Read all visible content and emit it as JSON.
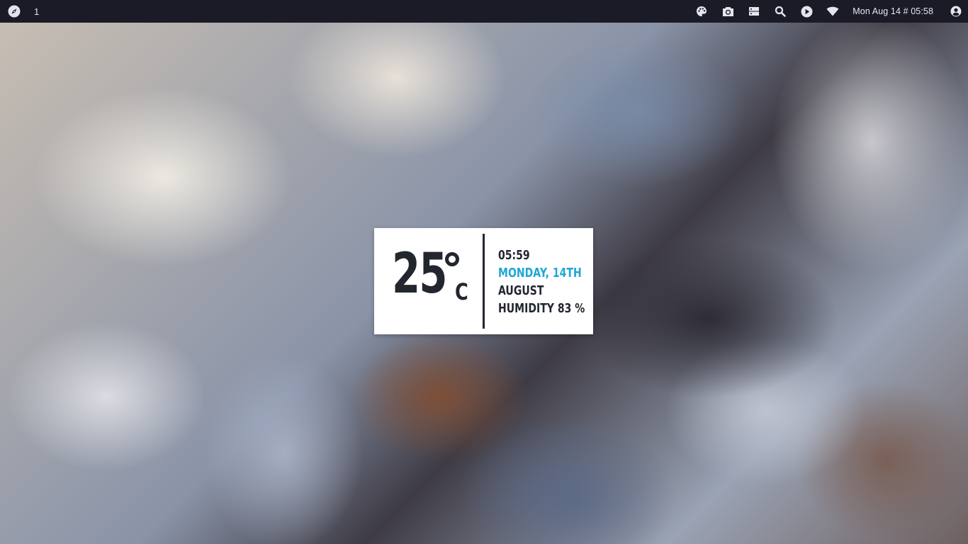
{
  "topbar": {
    "workspace": "1",
    "clock": "Mon Aug 14 # 05:58",
    "icons": [
      "compass-icon",
      "palette-icon",
      "camera-icon",
      "storage-icon",
      "search-icon",
      "play-icon",
      "wifi-icon",
      "user-account-icon"
    ]
  },
  "widget": {
    "temperature": "25",
    "unit": "C",
    "time": "05:59",
    "date": "MONDAY, 14TH",
    "month": "AUGUST",
    "humidity": "HUMIDITY 83 %"
  },
  "colors": {
    "topbar_bg": "#1b1b27",
    "topbar_text": "#e4e6ee",
    "widget_bg": "#ffffff",
    "widget_text": "#22262f",
    "accent": "#1fa6d6"
  }
}
